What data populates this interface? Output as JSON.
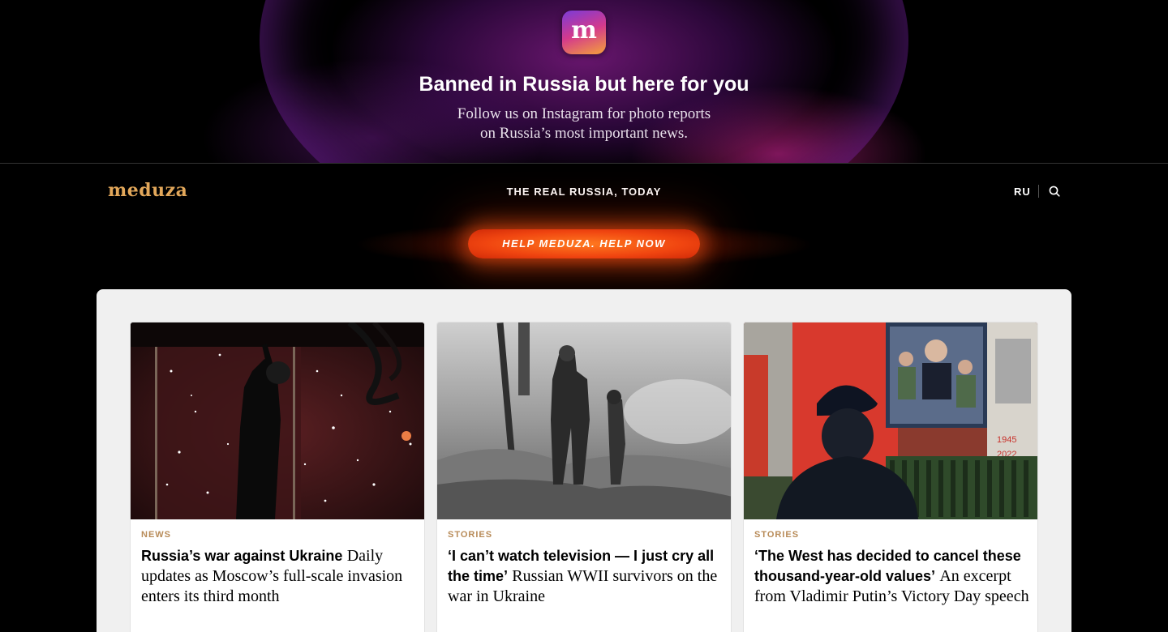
{
  "promo": {
    "logo_letter": "m",
    "title": "Banned in Russia but here for you",
    "subtitle_line1": "Follow us on Instagram for photo reports",
    "subtitle_line2": "on Russia’s most important news."
  },
  "header": {
    "logo": "meduza",
    "tagline": "THE REAL RUSSIA, TODAY",
    "lang": "RU",
    "help_button": "HELP MEDUZA. HELP NOW"
  },
  "cards": [
    {
      "tag": "NEWS",
      "title_bold": "Russia’s war against Ukraine",
      "title_rest": "Daily updates as Moscow’s full-scale invasion enters its third month"
    },
    {
      "tag": "STORIES",
      "title_bold": "‘I can’t watch television — I just cry all the time’",
      "title_rest": "Russian WWII survivors on the war in Ukraine"
    },
    {
      "tag": "STORIES",
      "title_bold": "‘The West has decided to cancel these thousand-year-old values’",
      "title_rest": "An excerpt from Vladimir Putin’s Victory Day speech",
      "image_text_1": "1945",
      "image_text_2": "2022"
    }
  ],
  "colors": {
    "accent": "#e2a75a",
    "tag": "#b88b58",
    "help": "#f04510"
  }
}
